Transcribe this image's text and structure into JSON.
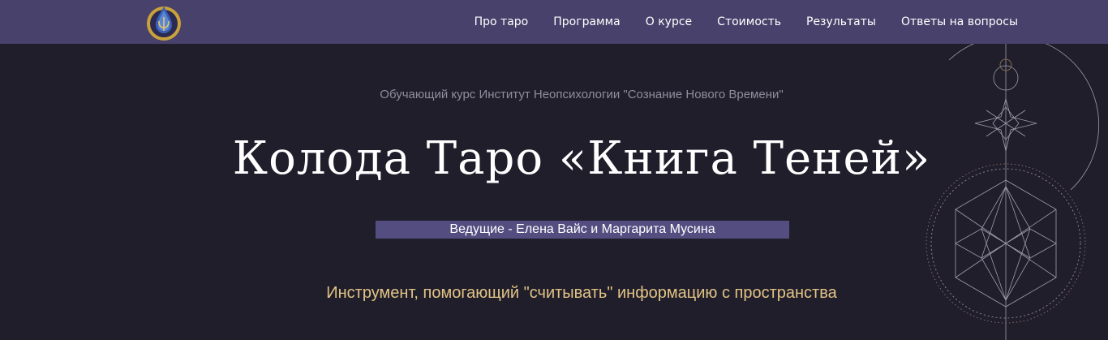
{
  "nav": {
    "items": [
      "Про таро",
      "Программа",
      "О курсе",
      "Стоимость",
      "Результаты",
      "Ответы на вопросы"
    ]
  },
  "hero": {
    "subtitle": "Обучающий курс Институт Неопсихологии \"Сознание Нового Времени\"",
    "title": "Колода Таро «Книга Теней»",
    "hosts": "Ведущие - Елена Вайс и Маргарита Мусина",
    "tagline": "Инструмент, помогающий \"считывать\" информацию с пространства"
  },
  "colors": {
    "background": "#211e2c",
    "header": "#48416b",
    "hosts_bg": "#544e80",
    "tagline": "#e1c384",
    "logo_gold": "#c9a23a"
  },
  "icons": {
    "logo": "psi-drop-logo-icon",
    "ornament": "sacred-geometry-star-ornament"
  }
}
